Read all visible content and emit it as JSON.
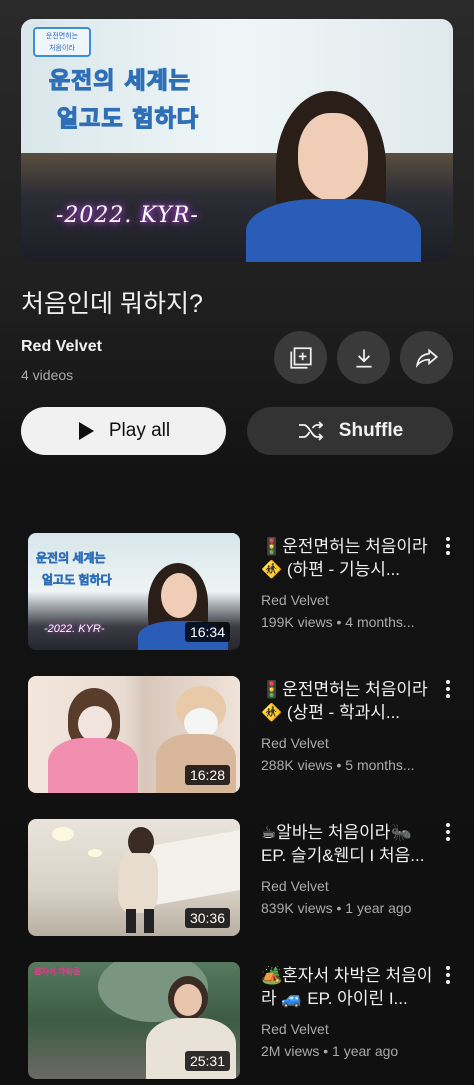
{
  "playlist": {
    "hero_overlay": {
      "line1": "운전의 세계는",
      "line2": "얼고도 험하다",
      "date": "-2022. KYR-"
    },
    "title": "처음인데 뭐하지?",
    "channel": "Red Velvet",
    "count": "4 videos"
  },
  "actions": {
    "play_all": "Play all",
    "shuffle": "Shuffle"
  },
  "videos": [
    {
      "title": "🚦운전면허는 처음이라 🚸 (하편 - 기능시...",
      "channel": "Red Velvet",
      "meta": "199K views • 4 months...",
      "duration": "16:34"
    },
    {
      "title": "🚦운전면허는 처음이라 🚸 (상편 - 학과시...",
      "channel": "Red Velvet",
      "meta": "288K views • 5 months...",
      "duration": "16:28"
    },
    {
      "title": "☕알바는 처음이라🐜 EP. 슬기&웬디 I 처음...",
      "channel": "Red Velvet",
      "meta": "839K views • 1 year ago",
      "duration": "30:36"
    },
    {
      "title": "🏕️혼자서 차박은 처음이라 🚙 EP. 아이린 I...",
      "channel": "Red Velvet",
      "meta": "2M views • 1 year ago",
      "duration": "25:31"
    }
  ],
  "icons": {
    "save": "save-to-library-icon",
    "download": "download-icon",
    "share": "share-icon",
    "play": "play-icon",
    "shuffle": "shuffle-icon",
    "more": "more-vertical-icon"
  }
}
